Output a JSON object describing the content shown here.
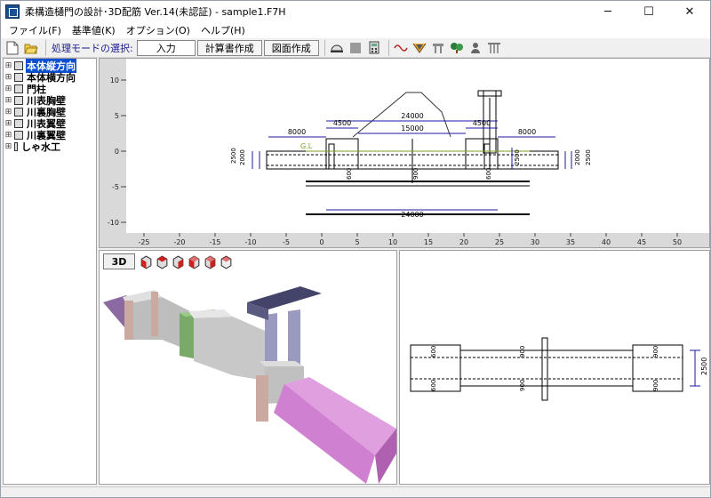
{
  "window": {
    "title": "柔構造樋門の設計･3D配筋 Ver.14(未認証) - sample1.F7H",
    "minimize": "─",
    "maximize": "☐",
    "close": "✕"
  },
  "menu": [
    "ファイル(F)",
    "基準値(K)",
    "オプション(O)",
    "ヘルプ(H)"
  ],
  "toolbar": {
    "mode_label": "処理モードの選択:",
    "mode_value": "入力",
    "calc_button": "計算書作成",
    "drawing_button": "図面作成",
    "icons": [
      "new-file-icon",
      "open-folder-icon",
      "helmet-icon",
      "gray-square-icon",
      "calculator-icon",
      "wave-icon",
      "cross-section-icon",
      "gate-icon",
      "tree-icon",
      "person-icon",
      "pillars-icon"
    ]
  },
  "tree": {
    "items": [
      {
        "label": "本体縦方向",
        "selected": true
      },
      {
        "label": "本体横方向",
        "selected": false
      },
      {
        "label": "門柱",
        "selected": false
      },
      {
        "label": "川表胸壁",
        "selected": false
      },
      {
        "label": "川裏胸壁",
        "selected": false
      },
      {
        "label": "川表翼壁",
        "selected": false
      },
      {
        "label": "川裏翼壁",
        "selected": false
      },
      {
        "label": "しゃ水工",
        "selected": false
      }
    ]
  },
  "profile_view": {
    "y_ticks": [
      "10",
      "5",
      "0",
      "-5",
      "-10"
    ],
    "x_ticks": [
      "-25",
      "-20",
      "-15",
      "-10",
      "-5",
      "0",
      "5",
      "10",
      "15",
      "20",
      "25",
      "30",
      "35",
      "40",
      "45",
      "50"
    ],
    "dims": {
      "left_8000": "8000",
      "left_4500": "4500",
      "top_24000": "24000",
      "mid_15000": "15000",
      "right_4500": "4500",
      "right_8000": "8000",
      "gl": "G.L",
      "left_2500": "2500",
      "left_2000": "2000",
      "right_2500a": "2500",
      "right_2000": "2000",
      "right_2500b": "2500",
      "bottom_24000": "24000",
      "pile_600a": "600",
      "pile_900": "900",
      "pile_600b": "600"
    }
  },
  "view3d": {
    "button": "3D",
    "cube_buttons": [
      "cube-front-icon",
      "cube-top-icon",
      "cube-left-icon",
      "cube-right-icon",
      "cube-back-icon",
      "cube-iso-icon"
    ]
  },
  "plan_view": {
    "dim_2500": "2500",
    "labels": [
      "600",
      "600",
      "900",
      "900",
      "900",
      "900"
    ]
  },
  "colors": {
    "selection": "#0a4fd1",
    "dim_blue": "#1a1aa0",
    "gl_green": "#7aa02a",
    "grid_gray": "#cfcfcf"
  }
}
